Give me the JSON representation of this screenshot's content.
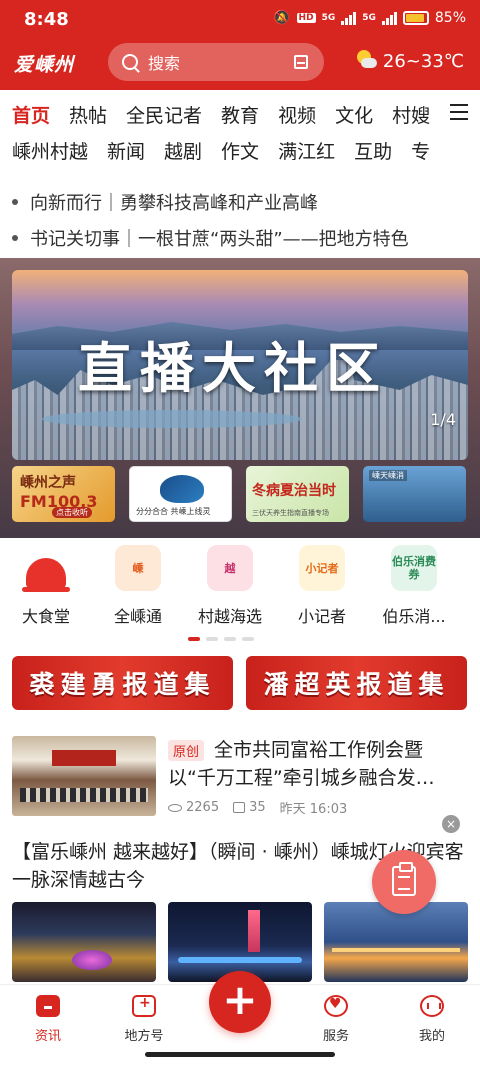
{
  "status_bar": {
    "time": "8:48",
    "hd": "HD",
    "net1": "5G",
    "net2": "5G",
    "battery": "85%"
  },
  "header": {
    "logo": "爱嵊州",
    "search_placeholder": "搜索",
    "weather": "26~33℃",
    "accent_color": "#d7261f"
  },
  "tabs": {
    "row1": [
      "首页",
      "热帖",
      "全民记者",
      "教育",
      "视频",
      "文化",
      "村嫂"
    ],
    "row2": [
      "嵊州村越",
      "新闻",
      "越剧",
      "作文",
      "满江红",
      "互助",
      "专"
    ],
    "active": "首页"
  },
  "headlines": [
    "向新而行｜勇攀科技高峰和产业高峰",
    "书记关切事｜一根甘蔗“两头甜”——把地方特色"
  ],
  "banner": {
    "title": "直播大社区",
    "pager": "1/4"
  },
  "thumbs": {
    "t1_a": "嵊州之声",
    "t1_b": "FM100.3",
    "t1_c": "点击收听",
    "t2_a": "分分合合  共嵊上线灵",
    "t3_a": "冬病夏治当时",
    "t3_b": "三伏天养生指南直播专场",
    "t4_a": "嵊天嵊消"
  },
  "icons": [
    {
      "label": "大食堂",
      "glyph": ""
    },
    {
      "label": "全嵊通",
      "glyph": "嵊"
    },
    {
      "label": "村越海选",
      "glyph": "越"
    },
    {
      "label": "小记者",
      "glyph": "小记者"
    },
    {
      "label": "伯乐消...",
      "glyph": "伯乐消费券"
    }
  ],
  "collections": {
    "left": "裘建勇报道集",
    "right": "潘超英报道集"
  },
  "news1": {
    "tag": "原创",
    "title": "全市共同富裕工作例会暨以“千万工程”牵引城乡融合发…",
    "views": "2265",
    "likes": "35",
    "time": "昨天 16:03"
  },
  "close_label": "×",
  "news2": {
    "title": "【富乐嵊州 越来越好】（瞬间 · 嵊州）嵊城灯火迎宾客 一脉深情越古今"
  },
  "bottom_nav": {
    "items": [
      "资讯",
      "地方号",
      "服务",
      "我的"
    ],
    "active": "资讯",
    "add_label": "+"
  }
}
